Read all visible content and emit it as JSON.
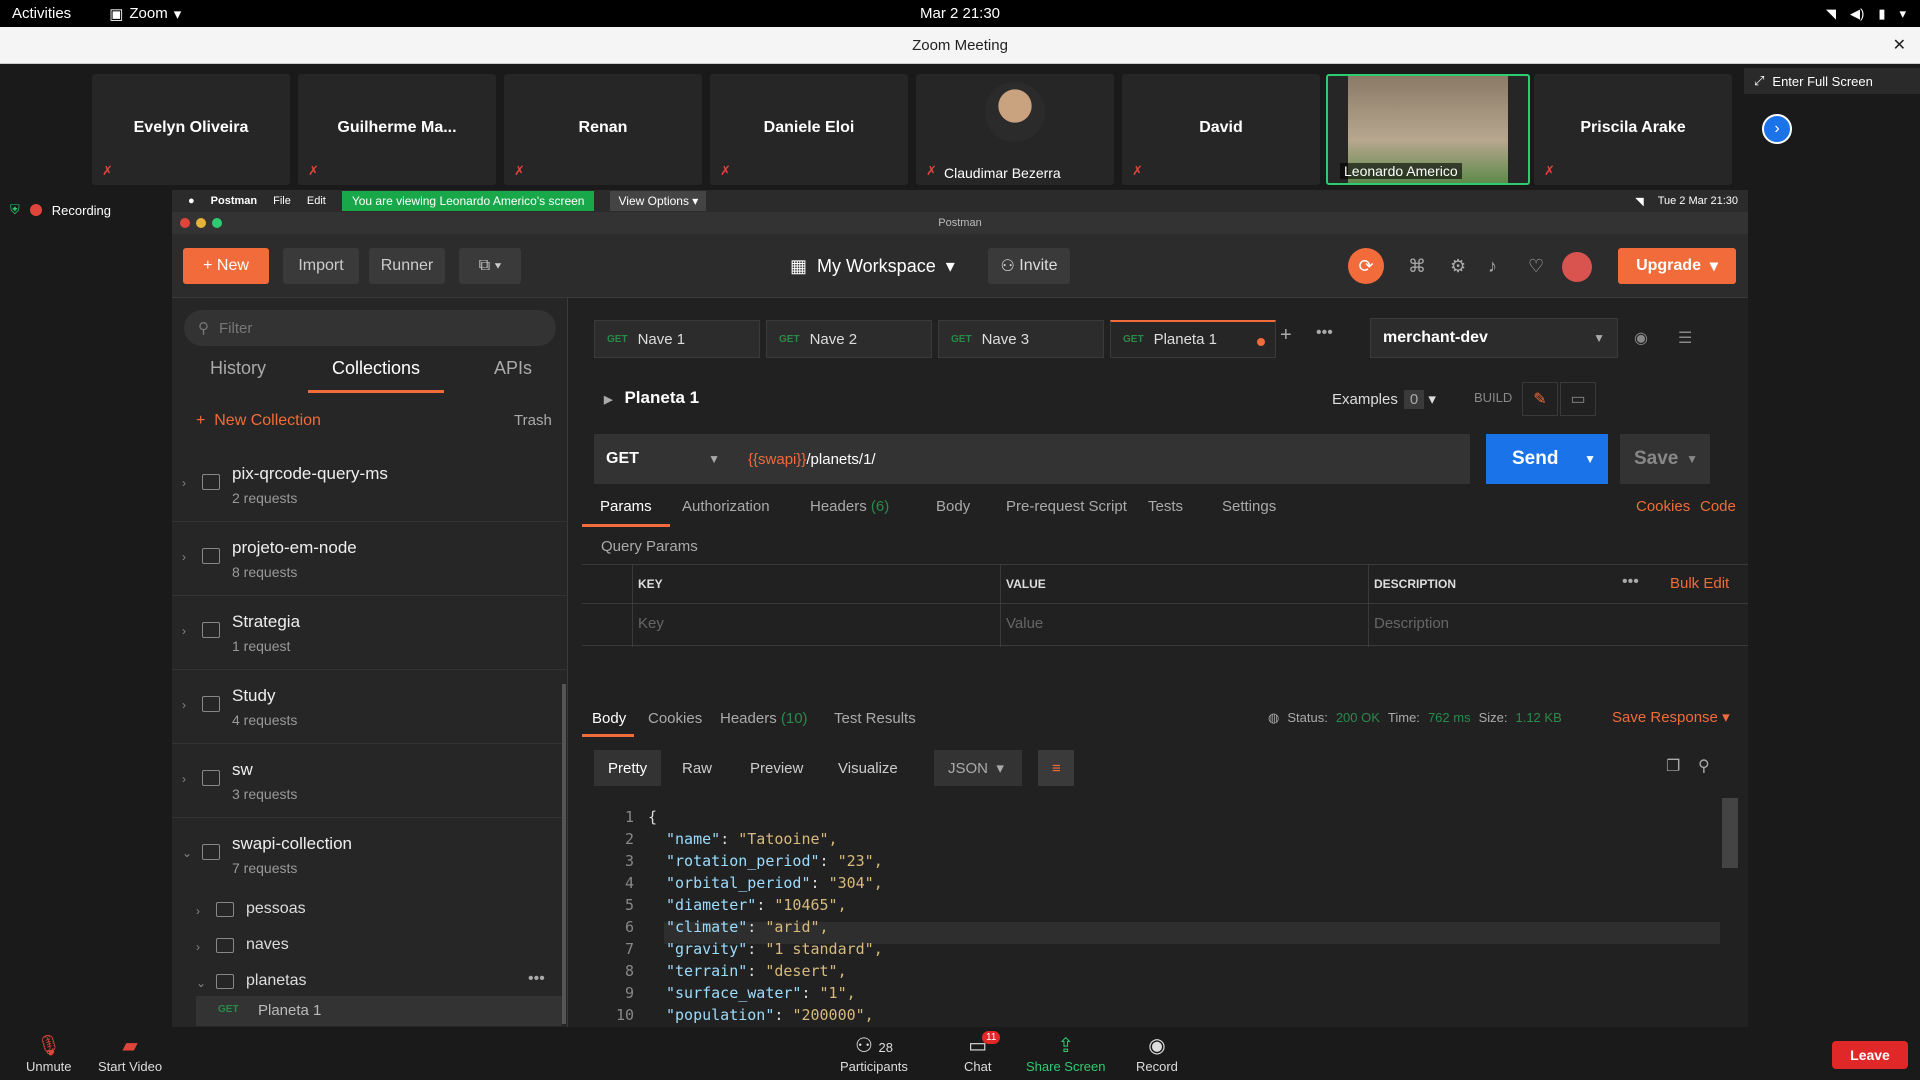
{
  "topbar": {
    "activities": "Activities",
    "app": "Zoom",
    "clock": "Mar 2  21:30"
  },
  "zoom": {
    "title": "Zoom Meeting",
    "fullscreen": "Enter Full Screen",
    "recording": "Recording",
    "participants": [
      "Evelyn Oliveira",
      "Guilherme Ma...",
      "Renan",
      "Daniele Eloi",
      "Claudimar Bezerra",
      "David",
      "Leonardo Americo",
      "Priscila Arake"
    ],
    "bottom": {
      "unmute": "Unmute",
      "start_video": "Start Video",
      "participants": "Participants",
      "participants_count": "28",
      "chat": "Chat",
      "chat_badge": "11",
      "share": "Share Screen",
      "record": "Record",
      "leave": "Leave"
    }
  },
  "mac": {
    "app": "Postman",
    "file": "File",
    "edit": "Edit",
    "banner": "You are viewing Leonardo Americo's screen",
    "view_options": "View Options",
    "clock": "Tue 2 Mar  21:30",
    "window_title": "Postman"
  },
  "postman": {
    "header": {
      "new": "New",
      "import": "Import",
      "runner": "Runner",
      "workspace": "My Workspace",
      "invite": "Invite",
      "upgrade": "Upgrade"
    },
    "sidebar": {
      "filter_placeholder": "Filter",
      "tabs": [
        "History",
        "Collections",
        "APIs"
      ],
      "new_collection": "New Collection",
      "trash": "Trash",
      "collections": [
        {
          "name": "pix-qrcode-query-ms",
          "requests": "2 requests"
        },
        {
          "name": "projeto-em-node",
          "requests": "8 requests"
        },
        {
          "name": "Strategia",
          "requests": "1 request"
        },
        {
          "name": "Study",
          "requests": "4 requests"
        },
        {
          "name": "sw",
          "requests": "3 requests"
        },
        {
          "name": "swapi-collection",
          "requests": "7 requests"
        }
      ],
      "folders": [
        "pessoas",
        "naves",
        "planetas"
      ],
      "request": {
        "method": "GET",
        "name": "Planeta 1"
      }
    },
    "tabs": [
      {
        "method": "GET",
        "name": "Nave 1"
      },
      {
        "method": "GET",
        "name": "Nave 2"
      },
      {
        "method": "GET",
        "name": "Nave 3"
      },
      {
        "method": "GET",
        "name": "Planeta 1"
      }
    ],
    "environment": "merchant-dev",
    "request": {
      "name": "Planeta 1",
      "examples": "Examples",
      "examples_count": "0",
      "build": "BUILD",
      "method": "GET",
      "url_var": "{{swapi}}",
      "url_path": "/planets/1/",
      "send": "Send",
      "save": "Save",
      "tabs": [
        "Params",
        "Authorization",
        "Headers",
        "Body",
        "Pre-request Script",
        "Tests",
        "Settings"
      ],
      "headers_count": "(6)",
      "cookies": "Cookies",
      "code": "Code",
      "query_title": "Query Params",
      "columns": [
        "KEY",
        "VALUE",
        "DESCRIPTION"
      ],
      "placeholders": [
        "Key",
        "Value",
        "Description"
      ],
      "bulk_edit": "Bulk Edit"
    },
    "response": {
      "tabs": [
        "Body",
        "Cookies",
        "Headers",
        "Test Results"
      ],
      "headers_count": "(10)",
      "status_label": "Status:",
      "status": "200 OK",
      "time_label": "Time:",
      "time": "762 ms",
      "size_label": "Size:",
      "size": "1.12 KB",
      "save_response": "Save Response",
      "views": [
        "Pretty",
        "Raw",
        "Preview",
        "Visualize"
      ],
      "format": "JSON",
      "lines": [
        {
          "n": "1",
          "text": "{"
        },
        {
          "n": "2",
          "key": "\"name\"",
          "val": "\"Tatooine\","
        },
        {
          "n": "3",
          "key": "\"rotation_period\"",
          "val": "\"23\","
        },
        {
          "n": "4",
          "key": "\"orbital_period\"",
          "val": "\"304\","
        },
        {
          "n": "5",
          "key": "\"diameter\"",
          "val": "\"10465\","
        },
        {
          "n": "6",
          "key": "\"climate\"",
          "val": "\"arid\","
        },
        {
          "n": "7",
          "key": "\"gravity\"",
          "val": "\"1 standard\","
        },
        {
          "n": "8",
          "key": "\"terrain\"",
          "val": "\"desert\","
        },
        {
          "n": "9",
          "key": "\"surface_water\"",
          "val": "\"1\","
        },
        {
          "n": "10",
          "key": "\"population\"",
          "val": "\"200000\","
        }
      ]
    }
  }
}
